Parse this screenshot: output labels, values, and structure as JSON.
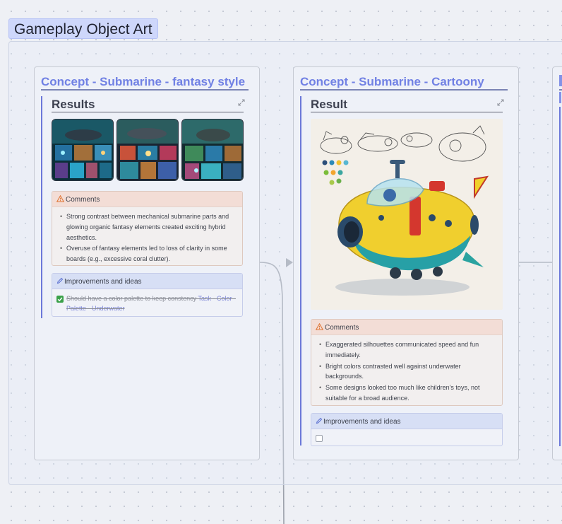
{
  "group": {
    "label": "Gameplay Object Art"
  },
  "card1": {
    "title": "Concept - Submarine - fantasy style",
    "section_title": "Results",
    "comments_label": "Comments",
    "comments": [
      "Strong contrast between mechanical submarine parts and glowing organic fantasy elements created exciting hybrid aesthetics.",
      "Overuse of fantasy elements led to loss of clarity in some boards (e.g., excessive coral clutter)."
    ],
    "improvements_label": "Improvements and ideas",
    "todo": {
      "text": "Should have a color palette to keep constency ",
      "link": "Task - Color - Palette - Underwater",
      "checked": true
    }
  },
  "card2": {
    "title": "Concept - Submarine - Cartoony",
    "section_title": "Result",
    "comments_label": "Comments",
    "comments": [
      "Exaggerated silhouettes communicated speed and fun immediately.",
      "Bright colors contrasted well against underwater backgrounds.",
      "Some designs looked too much like children’s toys, not suitable for a broad audience."
    ],
    "improvements_label": "Improvements and ideas",
    "todo": {
      "checked": false
    }
  },
  "colors": {
    "title_accent": "#7181e4",
    "comments_header": "#f3ddd6",
    "improvements_header": "#d7dff5",
    "check_green": "#3aa14a"
  }
}
